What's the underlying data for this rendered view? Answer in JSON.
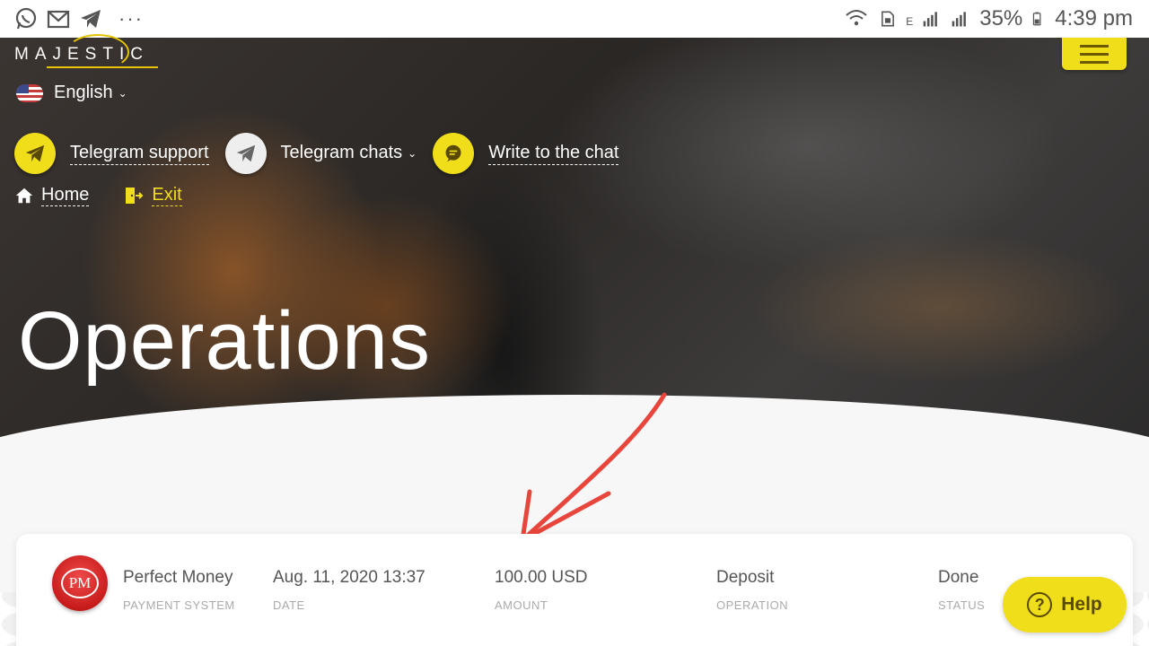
{
  "status_bar": {
    "left_icons": [
      "whatsapp-icon",
      "gmail-icon",
      "telegram-icon"
    ],
    "more": "···",
    "network_letter": "E",
    "battery": "35%",
    "time": "4:39 pm"
  },
  "header": {
    "logo": "MAJESTIC",
    "language": "English",
    "links": [
      {
        "label": "Telegram support",
        "icon": "telegram-icon"
      },
      {
        "label": "Telegram chats",
        "icon": "telegram-icon"
      },
      {
        "label": "Write to the chat",
        "icon": "chat-bubble-icon"
      }
    ],
    "nav": [
      {
        "label": "Home",
        "icon": "home-icon"
      },
      {
        "label": "Exit",
        "icon": "exit-icon"
      }
    ]
  },
  "page": {
    "title": "Operations"
  },
  "operation": {
    "payment_system": {
      "value": "Perfect Money",
      "label": "PAYMENT SYSTEM",
      "logo_text": "PM"
    },
    "date": {
      "value": "Aug. 11, 2020 13:37",
      "label": "DATE"
    },
    "amount": {
      "value": "100.00 USD",
      "label": "AMOUNT"
    },
    "operation": {
      "value": "Deposit",
      "label": "OPERATION"
    },
    "status": {
      "value": "Done",
      "label": "STATUS"
    }
  },
  "help": {
    "label": "Help"
  },
  "colors": {
    "accent": "#f0de1a",
    "annotation": "#e8453c"
  }
}
